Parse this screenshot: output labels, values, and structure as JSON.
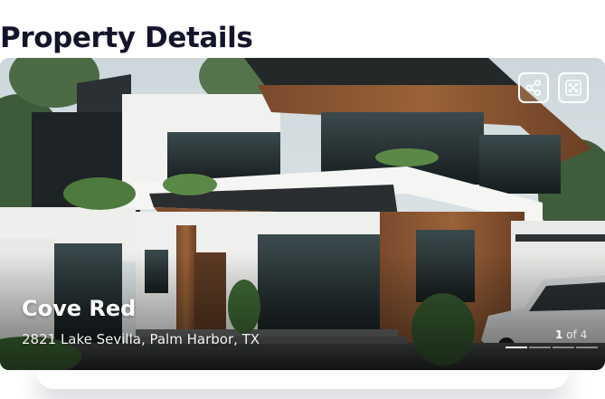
{
  "page": {
    "title": "Property Details"
  },
  "property": {
    "name": "Cove Red",
    "address": "2821 Lake Sevilla, Palm Harbor, TX",
    "photo": "modern-house-photo"
  },
  "actions": {
    "share_icon": "share-icon",
    "expand_icon": "expand-icon"
  },
  "gallery": {
    "current": "1",
    "separator": "of",
    "total": "4",
    "active_index": 1,
    "slide_count": 4
  },
  "colors": {
    "title": "#14152b",
    "overlay_text": "#ffffff",
    "button_border": "#ffffff"
  }
}
